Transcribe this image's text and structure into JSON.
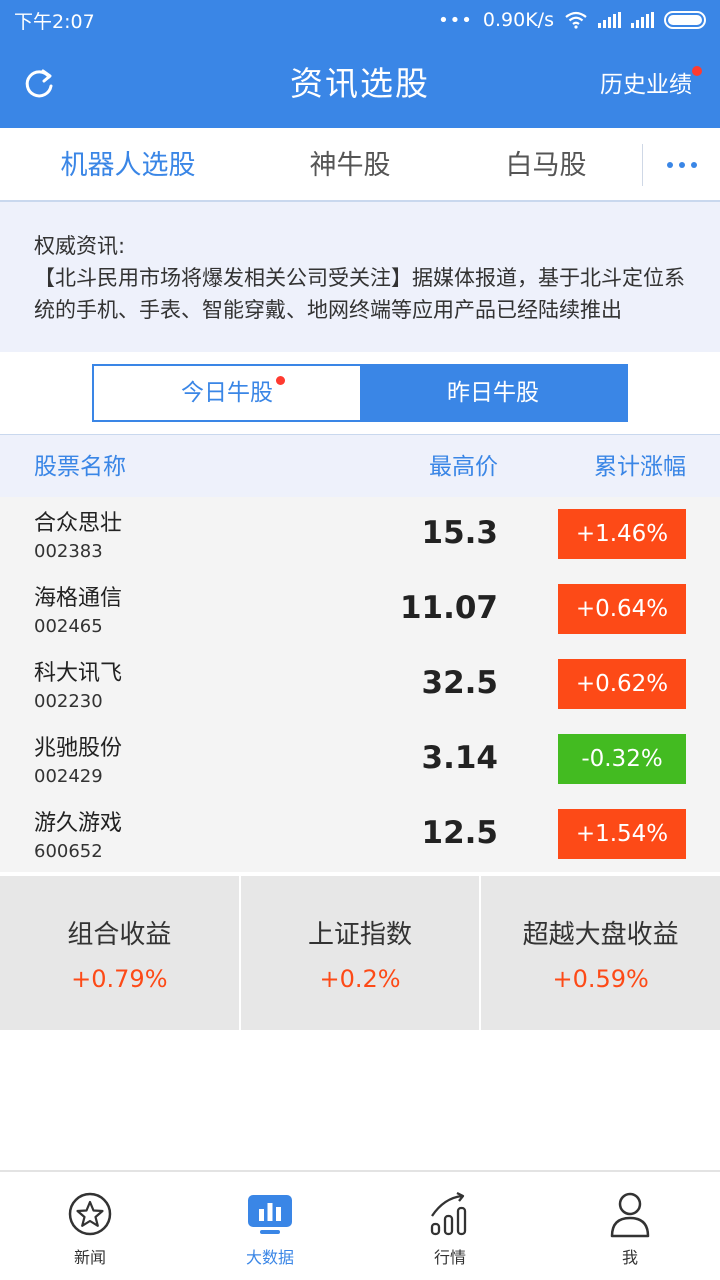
{
  "status_bar": {
    "time": "下午2:07",
    "network_speed": "0.90K/s"
  },
  "header": {
    "title": "资讯选股",
    "history_label": "历史业绩"
  },
  "tabs": [
    {
      "label": "机器人选股",
      "active": true
    },
    {
      "label": "神牛股",
      "active": false
    },
    {
      "label": "白马股",
      "active": false
    }
  ],
  "news": {
    "label": "权威资讯:",
    "text": "【北斗民用市场将爆发相关公司受关注】据媒体报道，基于北斗定位系统的手机、手表、智能穿戴、地网终端等应用产品已经陆续推出"
  },
  "segment": {
    "today_label": "今日牛股",
    "yesterday_label": "昨日牛股",
    "active": "yesterday"
  },
  "table": {
    "headers": {
      "name": "股票名称",
      "price": "最高价",
      "change": "累计涨幅"
    },
    "rows": [
      {
        "name": "合众思壮",
        "code": "002383",
        "price": "15.3",
        "change": "+1.46%",
        "direction": "up"
      },
      {
        "name": "海格通信",
        "code": "002465",
        "price": "11.07",
        "change": "+0.64%",
        "direction": "up"
      },
      {
        "name": "科大讯飞",
        "code": "002230",
        "price": "32.5",
        "change": "+0.62%",
        "direction": "up"
      },
      {
        "name": "兆驰股份",
        "code": "002429",
        "price": "3.14",
        "change": "-0.32%",
        "direction": "down"
      },
      {
        "name": "游久游戏",
        "code": "600652",
        "price": "12.5",
        "change": "+1.54%",
        "direction": "up"
      }
    ]
  },
  "summary": [
    {
      "label": "组合收益",
      "value": "+0.79%"
    },
    {
      "label": "上证指数",
      "value": "+0.2%"
    },
    {
      "label": "超越大盘收益",
      "value": "+0.59%"
    }
  ],
  "bottom_nav": [
    {
      "label": "新闻",
      "icon": "star-circle-icon",
      "active": false
    },
    {
      "label": "大数据",
      "icon": "big-data-icon",
      "active": true
    },
    {
      "label": "行情",
      "icon": "market-chart-icon",
      "active": false
    },
    {
      "label": "我",
      "icon": "user-icon",
      "active": false
    }
  ],
  "colors": {
    "primary": "#3a86e6",
    "up": "#fd4a17",
    "down": "#43bb21"
  }
}
